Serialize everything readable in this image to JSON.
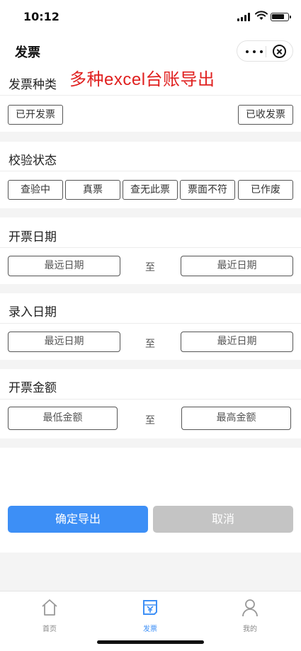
{
  "status": {
    "time": "10:12"
  },
  "nav": {
    "title": "发票"
  },
  "banner": "多种excel台账导出",
  "invoice_type": {
    "title": "发票种类",
    "options": [
      "已开发票",
      "已收发票"
    ]
  },
  "verify_status": {
    "title": "校验状态",
    "options": [
      "查验中",
      "真票",
      "查无此票",
      "票面不符",
      "已作废"
    ]
  },
  "issue_date": {
    "title": "开票日期",
    "from": "最远日期",
    "to_label": "至",
    "to": "最近日期"
  },
  "entry_date": {
    "title": "录入日期",
    "from": "最远日期",
    "to_label": "至",
    "to": "最近日期"
  },
  "amount": {
    "title": "开票金额",
    "from": "最低金额",
    "to_label": "至",
    "to": "最高金额"
  },
  "actions": {
    "confirm": "确定导出",
    "cancel": "取消"
  },
  "tabbar": {
    "items": [
      {
        "label": "首页",
        "icon": "home-icon"
      },
      {
        "label": "发票",
        "icon": "invoice-icon"
      },
      {
        "label": "我的",
        "icon": "user-icon"
      }
    ],
    "active_color": "#3d8ff6"
  },
  "colors": {
    "primary": "#3d8ff6",
    "banner": "#e0201f",
    "cancel": "#c4c4c4"
  }
}
